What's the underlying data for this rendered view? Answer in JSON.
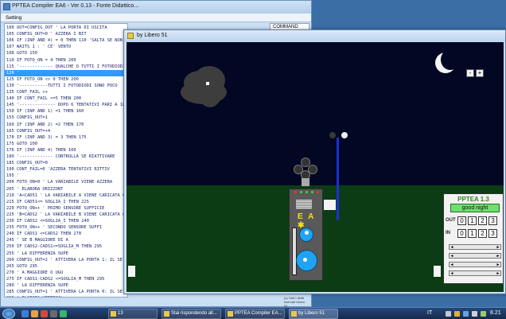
{
  "compiler": {
    "title": "PPTEA Compiler EA6 - Ver 0.13 - Fonte Didattico...",
    "menu": "Setting",
    "command_tab": "COMMAND",
    "code_lines": [
      "100 OUT=CONFIG_OUT       ' LA PORTA DI USCITA",
      "105 CONFIG_OUT=0         ' AZZERA I BIT",
      "106 IF (INP AND 4) = 0 THEN 110 'SALTA SE NON C",
      "107 WAITS 1 : ' CE' VENTO",
      "108 GOTO 150",
      "110 IF FOTO_ON = 4 THEN 200",
      "115 '------------- QUALCHE O TUTTI I FOTODIODI S",
      "120 '",
      "125 IF FOTO_ON <> 0 THEN 200",
      "130 '-----------TUTTI I FOTODIODI SONO POCO",
      "135 CONT_FAIL ++",
      "140 IF CONT_FAIL <=5 THEN 200",
      "145 '-------------- DOPO 6 TENTATIVI PARI A 18 MIN",
      "150 IF (INP AND 1) =1 THEN 160",
      "155 CONFIG_OUT=1",
      "160 IF (INP AND 2) =2 THEN 170",
      "165 CONFIG_OUT=+4",
      "170 IF (INP AND 3) = 3 THEN 175",
      "175 GOTO 100",
      "176 IF (INP AND 4) THEN 100",
      "180 '------------- CONTROLLA SE RIATTIVARE",
      "185 CONFIG_OUT=0",
      "190 CONT_FAIL=0         'AZZERA TENTATIVI RITTIV",
      "195 '",
      "200 FOTO_ON=0           ' LA VARIABILE VIENE AZZERA",
      "205 '                   ELABORA ORIZZONT",
      "210 'A<CAD51 ' LA VARIABILE A VIENE CARICATA CO",
      "215 IF CAD51<= SOGLIA_I THEN 225",
      "220 FOTO_ON++           ' PRIMO SENSORE SUFFICIE",
      "225 'B=CADS2 ' LA VARIABILE B VIENE CARICATA CO",
      "230 IF CADS2 <=SOGLIA_I THEN 240",
      "235 FOTO_ON++           ' SECONDO SENSORE SUFFI",
      "240 IF CADS1 <=CADS2 THEN 270",
      "245 '                   SE B MAGGIORE DI A",
      "250 IF CADS2-CADS1<=SOGLIA_M THEN 295",
      "255 '                   LA DIFFERENZA SUPE",
      "260 CONFIG_OUT=2 ' ATTIVERA LA PORTA 1: IL SE",
      "265 GOTO 295",
      "270 '                   A MAGGIORE O UGU",
      "275 IF CADS1-CADS2 <=SOGLIA_M THEN 295",
      "280 '                   LA DIFFERENZA SUPE",
      "285 CONFIG_OUT=1 ' ATTIVERA LA PORTA 0: IL SE",
      "290 '                   ELABORA VERTICAL",
      "295 'A<CADS3 ' LA VARIABILE A VIENE CARICATA CO",
      "300 IF CADS3<= SOGLIA_I THEN 310",
      "305 FOTO_ON++           ' TERZO SENSORE SUFFICIE"
    ],
    "selected_line_index": 7,
    "footer_small": "(c) Tutti i diritti riservati Libero 51"
  },
  "sim": {
    "title": "by Libero 51",
    "zoom_minus": "-",
    "zoom_plus": "+",
    "board_label": "E A ✱",
    "panel": {
      "title": "PPTEA 1.3",
      "status": "good night",
      "out_label": "OUT",
      "in_label": "IN",
      "out_values": [
        "0",
        "1",
        "2",
        "3"
      ],
      "in_values": [
        "0",
        "1",
        "2",
        "3"
      ],
      "arrow_left": "◄",
      "arrow_right": "►",
      "bar_count": 4
    }
  },
  "taskbar": {
    "tasks": [
      {
        "label": "13"
      },
      {
        "label": "Stai rispondendo all..."
      },
      {
        "label": "PPTEA Compiler EA..."
      },
      {
        "label": "by Libero 51"
      }
    ],
    "language": "IT",
    "clock": "8.21"
  }
}
